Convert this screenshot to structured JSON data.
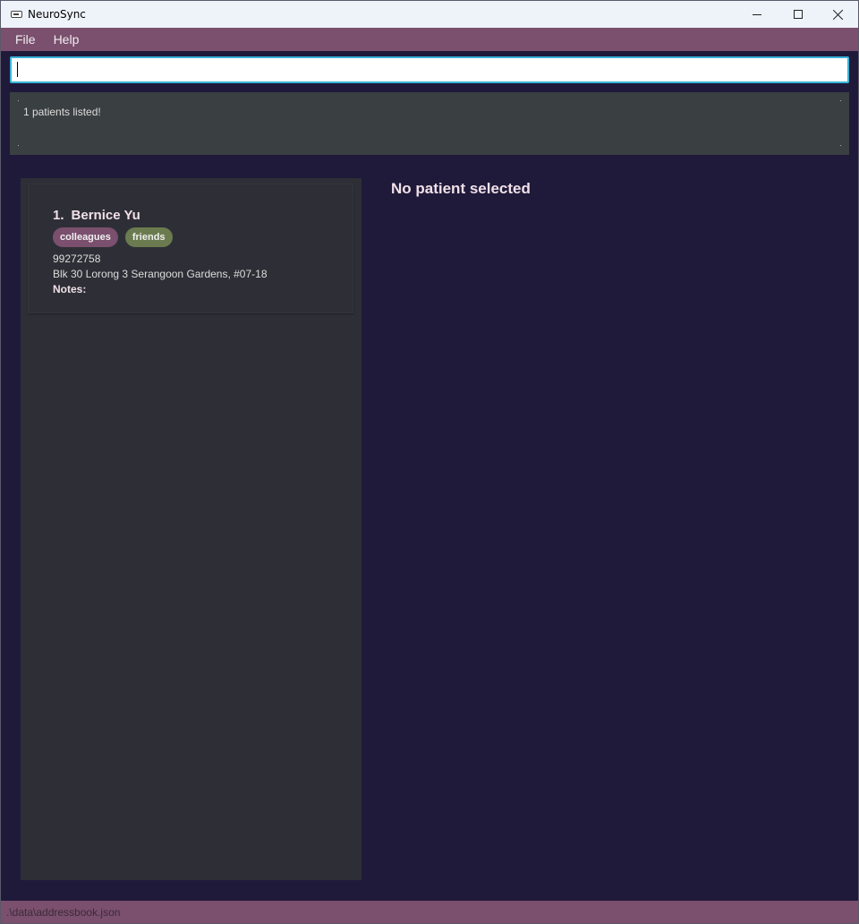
{
  "window": {
    "title": "NeuroSync"
  },
  "menu": {
    "items": [
      "File",
      "Help"
    ]
  },
  "command_box": {
    "value": "",
    "placeholder": ""
  },
  "result_display": {
    "message": "1 patients listed!"
  },
  "patient_list": {
    "patients": [
      {
        "index": "1.",
        "name": "Bernice Yu",
        "tags": [
          {
            "label": "colleagues",
            "color": "#7b4f6e"
          },
          {
            "label": "friends",
            "color": "#6b7b4f"
          }
        ],
        "phone": "99272758",
        "address": "Blk 30 Lorong 3 Serangoon Gardens, #07-18",
        "notes_label": "Notes:"
      }
    ]
  },
  "detail_panel": {
    "empty_message": "No patient selected"
  },
  "status_bar": {
    "file_path": ".\\data\\addressbook.json"
  },
  "colors": {
    "background": "#1f1a3a",
    "menu_bar": "#7b4f6e",
    "panel": "#2e2f36",
    "result_box": "#3a3f41",
    "accent": "#3ab4d8"
  }
}
